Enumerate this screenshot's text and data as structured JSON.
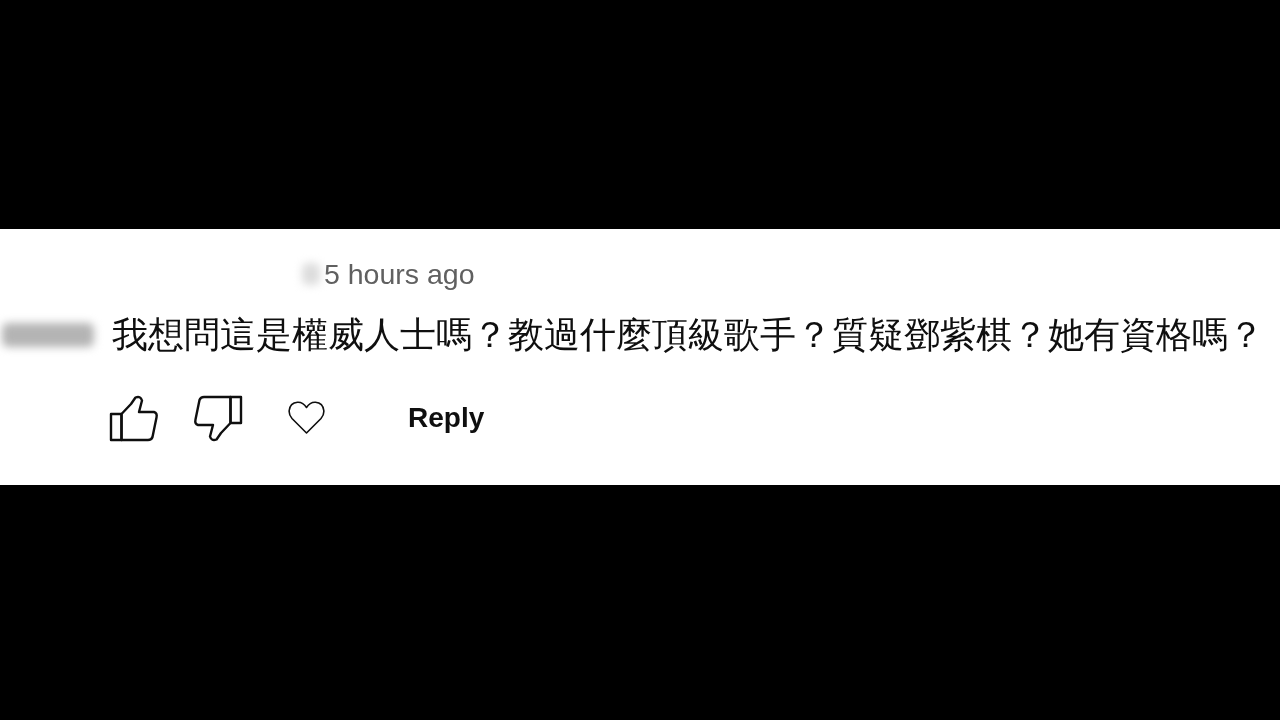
{
  "comment": {
    "time": "5 hours ago",
    "text": "我想問這是權威人士嗎？教過什麼頂級歌手？質疑鄧紫棋？她有資格嗎？",
    "actions": [
      {
        "kind": "like"
      },
      {
        "kind": "dislike"
      },
      {
        "kind": "heart"
      }
    ],
    "reply": "Reply"
  }
}
